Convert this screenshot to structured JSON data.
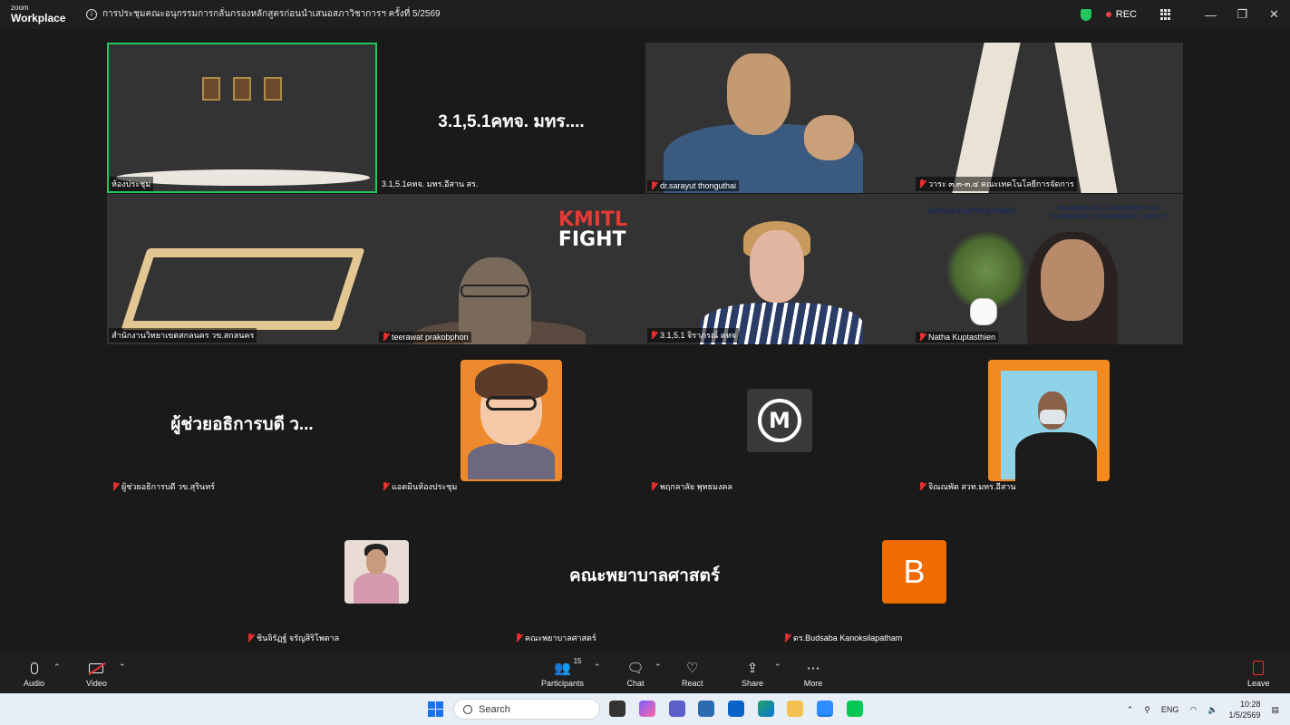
{
  "app": {
    "brand_small": "zoom",
    "brand_big": "Workplace",
    "meeting_title": "การประชุมคณะอนุกรรมการกลั่นกรองหลักสูตรก่อนนำเสนอสภาวิชาการฯ ครั้งที่ 5/2569",
    "rec_label": "REC"
  },
  "gallery": {
    "row1": [
      {
        "name": "ห้องประชุม",
        "type": "video",
        "active": true
      },
      {
        "name": "3.1,5.1คทจ. มทร.อีสาน สร.",
        "type": "text",
        "display": "3.1,5.1คทจ. มทร...."
      },
      {
        "name": "dr.sarayut thonguthai",
        "type": "video",
        "muted": true
      },
      {
        "name": "วาระ ๓.๓-๓.๔ คณะเทคโนโลยีการจัดการ",
        "type": "video",
        "muted": true
      }
    ],
    "row2": [
      {
        "name": "สำนักงานวิทยาเขตสกลนคร วข.สกลนคร",
        "type": "video"
      },
      {
        "name": "teerawat prakobphon",
        "type": "video",
        "muted": true,
        "logo_line1": "KMITL",
        "logo_line2": "FIGHT"
      },
      {
        "name": "3.1,5.1 จิราภรณ์ คทจ",
        "type": "video",
        "muted": true
      },
      {
        "name": "Natha Kuptasthien",
        "type": "video",
        "muted": true,
        "banner_left": "NATHA KUPTASTHIEN",
        "banner_right_1": "RAJAMANGALA UNIVERSITY OF",
        "banner_right_2": "TECHNOLOGY THANYABURI – RMUTT"
      }
    ],
    "row3": [
      {
        "name": "ผู้ช่วยอธิการบดี วข.สุรินทร์",
        "type": "text",
        "display": "ผู้ช่วยอธิการบดี ว...",
        "muted": true
      },
      {
        "name": "แอดมินห้องประชุม",
        "type": "avatar",
        "avatar_icon": "cartoon-man-icon",
        "muted": true
      },
      {
        "name": "พฤกลาลัย พุทธมงคล",
        "type": "avatar",
        "avatar_icon": "m-logo-icon",
        "avatar_letter": "M",
        "muted": true
      },
      {
        "name": "จิณณพัต สวท.มทร.อีสาน",
        "type": "avatar",
        "avatar_icon": "profile-photo-icon",
        "muted": true
      }
    ],
    "row4": [
      {
        "name": "ชินจิรัฏฐ์ จรัญสิริโพตาล",
        "type": "avatar",
        "avatar_icon": "profile-photo-icon",
        "muted": true
      },
      {
        "name": "คณะพยาบาลศาสตร์",
        "type": "text",
        "display": "คณะพยาบาลศาสตร์",
        "muted": true
      },
      {
        "name": "ดร.Budsaba Kanoksilapatham",
        "type": "avatar",
        "avatar_letter": "B",
        "muted": true
      }
    ]
  },
  "controls": {
    "audio": "Audio",
    "video": "Video",
    "participants": "Participants",
    "participants_count": "15",
    "chat": "Chat",
    "react": "React",
    "share": "Share",
    "more": "More",
    "leave": "Leave"
  },
  "taskbar": {
    "search_placeholder": "Search",
    "lang": "ENG",
    "time": "10:28",
    "date": "1/5/2569"
  },
  "colors": {
    "active_border": "#22c55e",
    "muted_red": "#e83030",
    "avatar_orange": "#ef6c00"
  }
}
